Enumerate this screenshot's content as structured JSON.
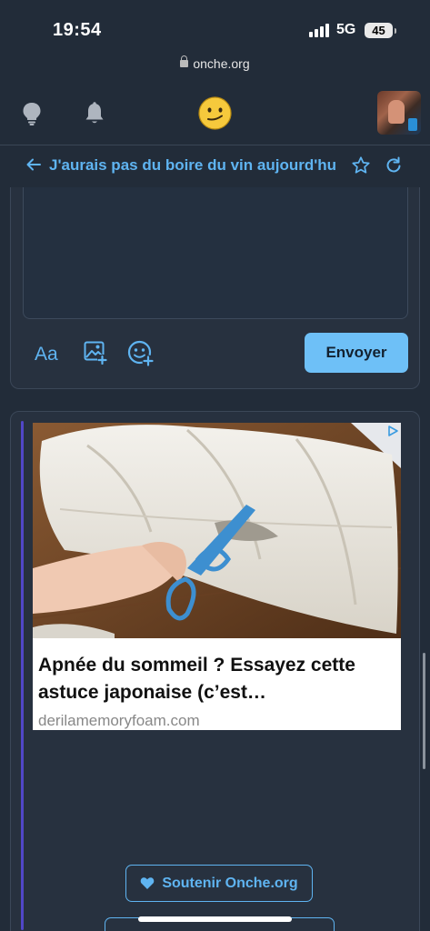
{
  "status_bar": {
    "time": "19:54",
    "network": "5G",
    "battery": "45"
  },
  "browser": {
    "url": "onche.org"
  },
  "topic": {
    "title": "J'aurais pas du boire du vin aujourd'hu"
  },
  "editor": {
    "font_button": "Aa",
    "send_label": "Envoyer"
  },
  "ad": {
    "headline": "Apnée du sommeil ? Essayez cette astuce japonaise (c’est…",
    "domain": "derilamemoryfoam.com"
  },
  "support": {
    "label": "Soutenir Onche.org"
  },
  "icons": {
    "bulb": "lightbulb-icon",
    "bell": "bell-icon",
    "logo": "emoji-logo",
    "back": "arrow-left-icon",
    "star": "star-icon",
    "refresh": "refresh-icon",
    "image": "image-add-icon",
    "emoji": "emoji-add-icon",
    "heart": "heart-icon",
    "ad_choices": "ad-choices-icon"
  },
  "colors": {
    "accent": "#5fb4f1",
    "button": "#6ec0f7",
    "background": "#222c39",
    "card": "#27313f",
    "post_accent": "#5147c7"
  }
}
